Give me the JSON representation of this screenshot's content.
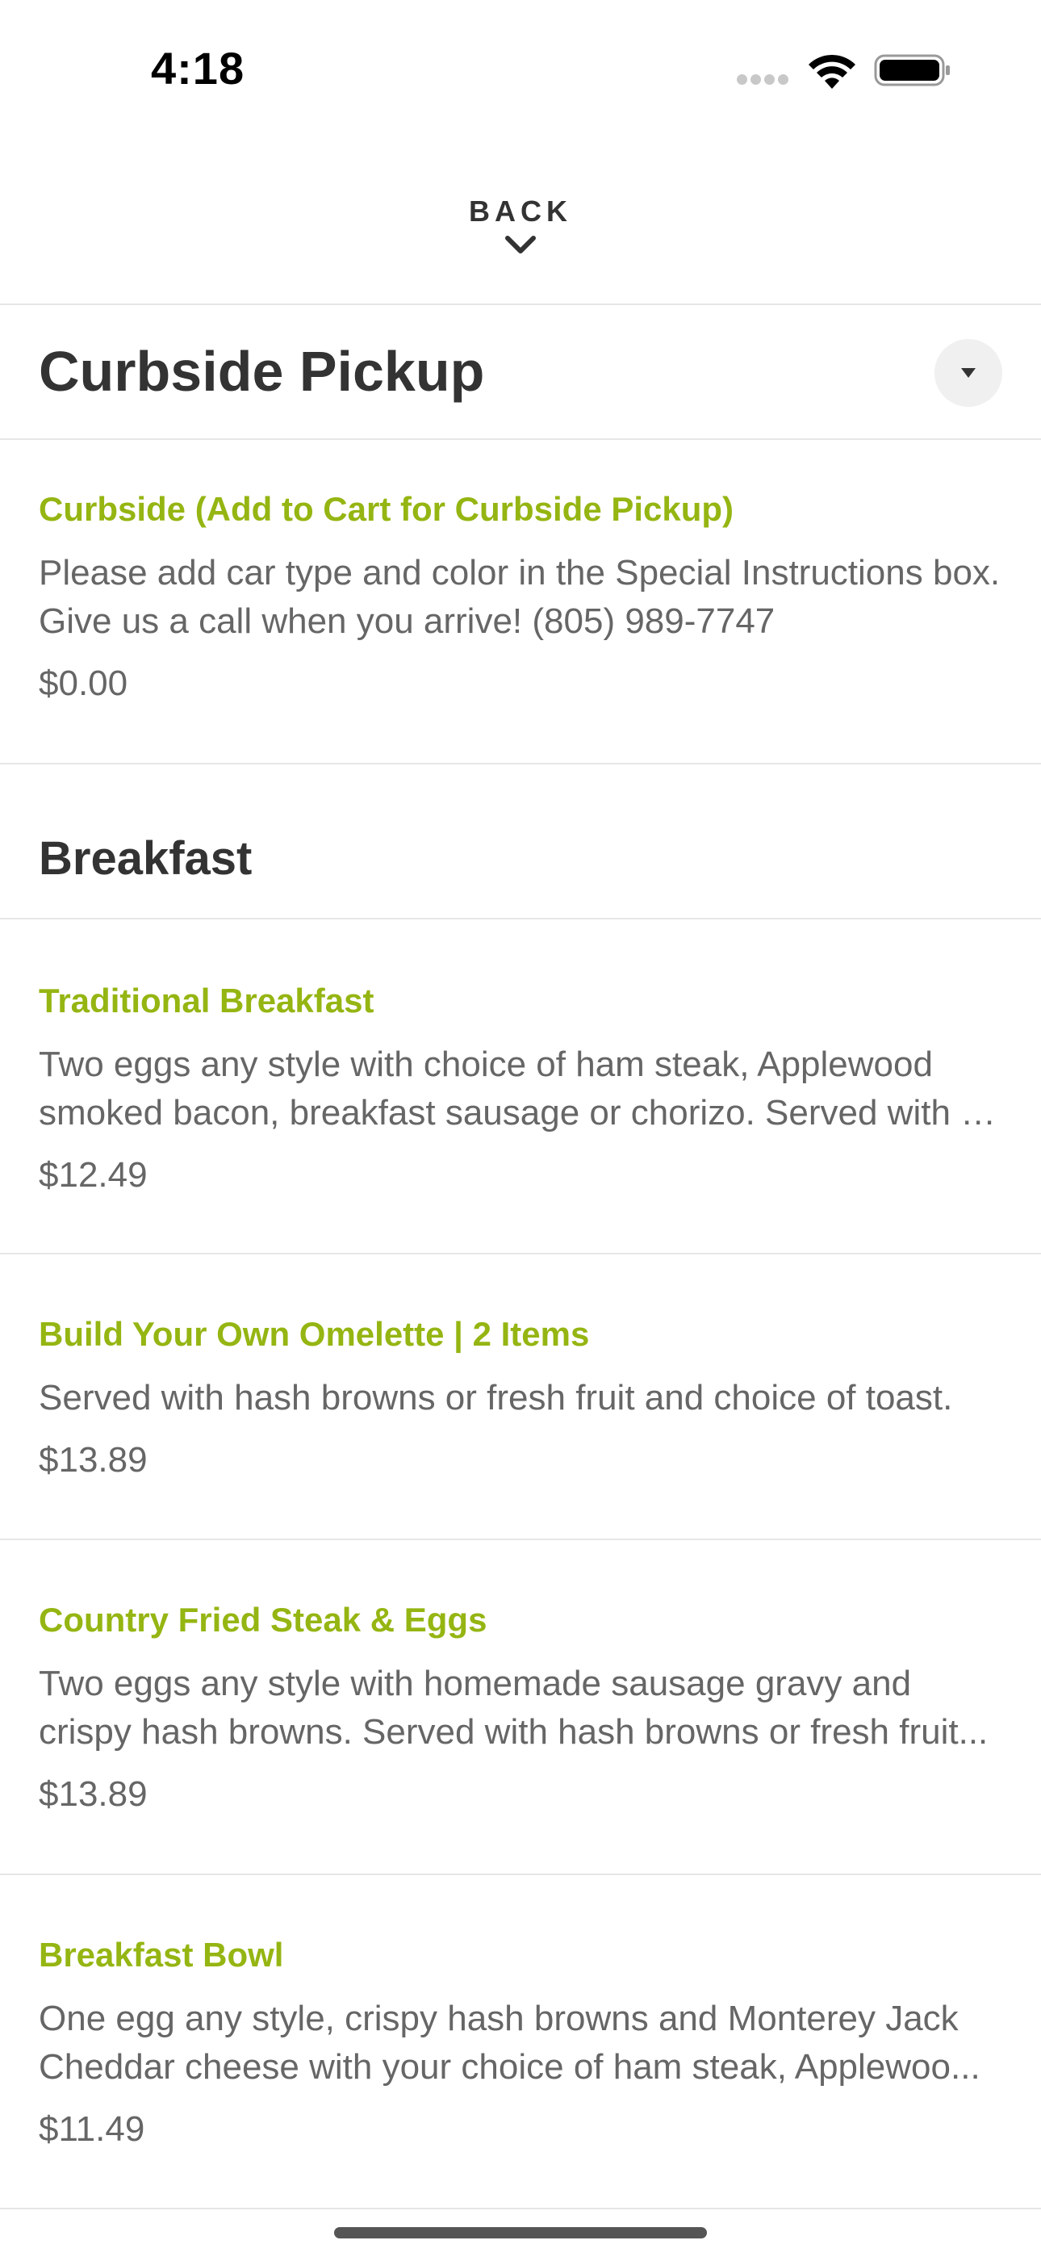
{
  "status_bar": {
    "time": "4:18"
  },
  "nav": {
    "back_label": "BACK"
  },
  "sections": [
    {
      "title": "Curbside Pickup",
      "items": [
        {
          "name": "Curbside (Add to Cart for Curbside Pickup)",
          "desc_lines": [
            "Please add car type and color in the Special Instructions box.",
            "Give us a call when you arrive! (805) 989-7747"
          ],
          "price": "$0.00"
        }
      ]
    },
    {
      "title": "Breakfast",
      "items": [
        {
          "name": "Traditional Breakfast",
          "desc_lines": [
            "Two eggs any style with choice of ham steak, Applewood",
            "smoked bacon, breakfast sausage or chorizo. Served with h..."
          ],
          "price": "$12.49"
        },
        {
          "name": "Build Your Own Omelette | 2 Items",
          "desc_lines": [
            "Served with hash browns or fresh fruit and choice of toast."
          ],
          "price": "$13.89"
        },
        {
          "name": "Country Fried Steak & Eggs",
          "desc_lines": [
            "Two eggs any style with homemade sausage gravy and",
            "crispy hash browns. Served with hash browns or fresh fruit..."
          ],
          "price": "$13.89"
        },
        {
          "name": "Breakfast Bowl",
          "desc_lines": [
            "One egg any style, crispy hash browns and Monterey Jack",
            "Cheddar cheese with your choice of ham steak, Applewoo..."
          ],
          "price": "$11.49"
        }
      ]
    }
  ],
  "colors": {
    "accent": "#95b512",
    "text": "#333333",
    "muted": "#666666"
  }
}
